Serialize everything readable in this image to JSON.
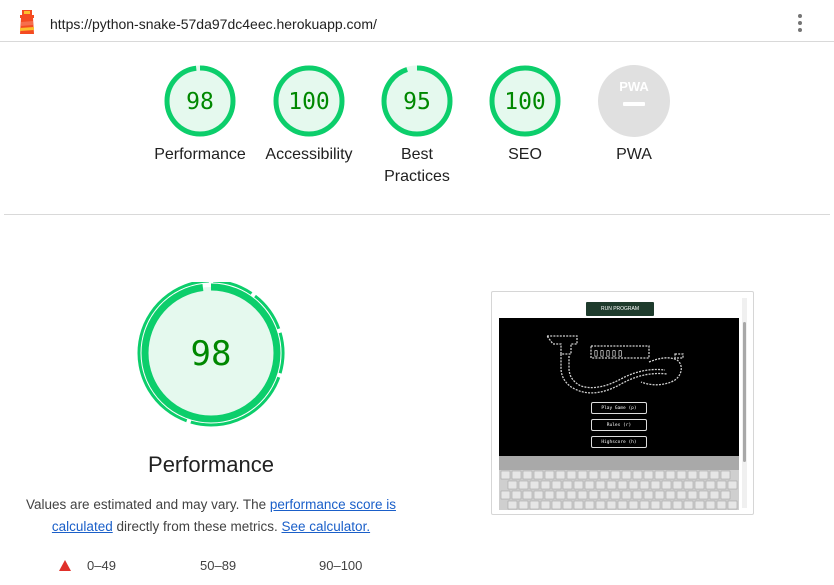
{
  "header": {
    "url": "https://python-snake-57da97dc4eec.herokuapp.com/",
    "logo_icon": "lighthouse-icon",
    "menu_icon": "kebab-menu-icon"
  },
  "categories": [
    {
      "name": "Performance",
      "score": "98",
      "value": 98
    },
    {
      "name": "Accessibility",
      "score": "100",
      "value": 100
    },
    {
      "name": "Best Practices",
      "score": "95",
      "value": 95
    },
    {
      "name": "SEO",
      "score": "100",
      "value": 100
    },
    {
      "name": "PWA",
      "score": "",
      "badge": "PWA",
      "value": null
    }
  ],
  "performance": {
    "score": "98",
    "value": 98,
    "title": "Performance",
    "desc_prefix": "Values are estimated and may vary. The ",
    "link_score": "performance score is calculated",
    "desc_middle": " directly from these metrics. ",
    "link_calc": "See calculator."
  },
  "legend": {
    "fail": "0–49",
    "average": "50–89",
    "pass": "90–100"
  },
  "thumbnail": {
    "run_button": "RUN PROGRAM",
    "menu": [
      "Play Game (p)",
      "Rules (r)",
      "Highscore (h)"
    ]
  },
  "colors": {
    "pass": "#0cce6b",
    "pass_fill": "#e5f9ee",
    "pass_text": "#008800",
    "fail": "#e0302a",
    "pwa_gray": "#e0e0e0"
  }
}
